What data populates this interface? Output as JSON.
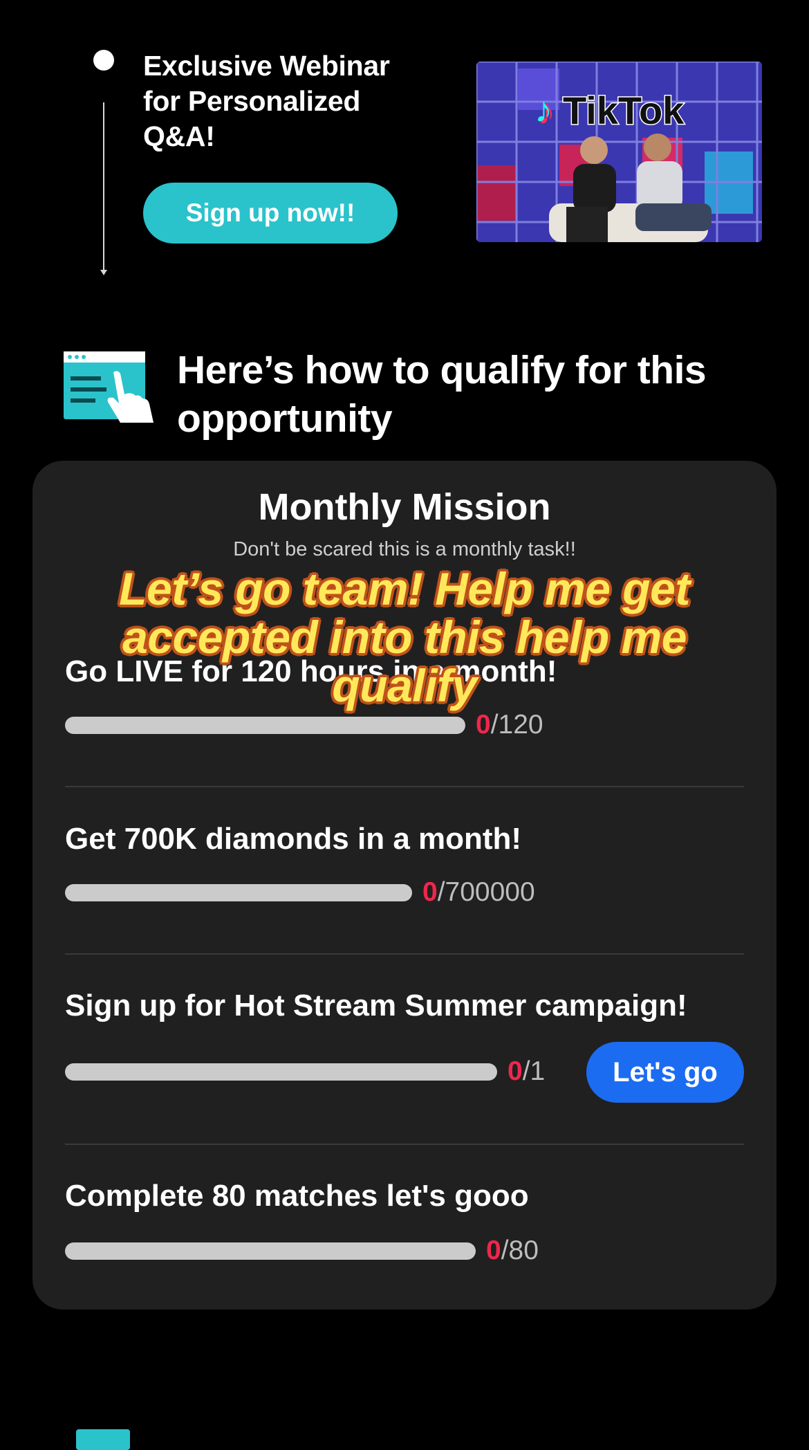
{
  "webinar": {
    "title": "Exclusive Webinar for Personalized Q&A!",
    "signup_label": "Sign up now!!",
    "photo_brand": "TikTok"
  },
  "qualify": {
    "title": "Here’s how to qualify for this opportunity"
  },
  "mission": {
    "title": "Monthly Mission",
    "subtitle": "Don't be scared this is a monthly task!!",
    "tasks": [
      {
        "title": "Go LIVE for 120 hours in a month!",
        "current": "0",
        "total": "/120",
        "progress": 0
      },
      {
        "title": "Get 700K diamonds in a month!",
        "current": "0",
        "total": "/700000",
        "progress": 0
      },
      {
        "title": "Sign up for Hot Stream Summer campaign!",
        "current": "0",
        "total": "/1",
        "progress": 0,
        "action_label": "Let's go"
      },
      {
        "title": "Complete 80 matches let's gooo",
        "current": "0",
        "total": "/80",
        "progress": 0
      }
    ]
  },
  "overlay_caption": "Let’s go team! Help me get accepted into this help me qualify",
  "colors": {
    "accent_teal": "#2ac3cb",
    "primary_blue": "#1c6cf2",
    "counter_red": "#f0264c",
    "card_bg": "#202020"
  }
}
